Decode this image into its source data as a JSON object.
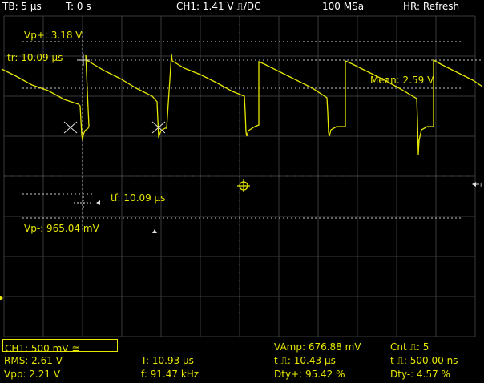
{
  "status_bar": {
    "timebase": "TB: 5 µs",
    "trigger_time": "T: 0 s",
    "channel_trigger": "CH1: 1.41 V ⎍/DC",
    "sample_rate": "100 MSa",
    "horizontal_mode": "HR: Refresh"
  },
  "cursor_labels": {
    "vp_plus": "Vp+: 3.18 V",
    "rise_time": "tr: 10.09 µs",
    "mean": "Mean: 2.59 V",
    "fall_time": "tf: 10.09 µs",
    "vp_minus": "Vp-: 965.04 mV",
    "trigger_marker": "T"
  },
  "channel_box": {
    "label": "CH1: 500 mV ≅"
  },
  "measurements": {
    "rms": "RMS: 2.61 V",
    "vpp": "Vpp: 2.21 V",
    "period": "T: 10.93 µs",
    "frequency": "f: 91.47 kHz",
    "vamp": "VAmp: 676.88 mV",
    "pos_pulse_width": "t ⎍: 10.43 µs",
    "pos_duty": "Dty+: 95.42 %",
    "rising_count": "Cnt ⎍: 5",
    "neg_pulse_width": "t ⎍: 500.00 ns",
    "neg_duty": "Dty-: 4.57 %"
  },
  "colors": {
    "trace": "#e6e600",
    "grid": "#3a3a3a",
    "dotted_lines": "#c9c9c9",
    "background": "#000000"
  },
  "icons": {
    "center_marker": "crosshair-icon",
    "trigger_arrow": "trigger-arrow-icon"
  }
}
